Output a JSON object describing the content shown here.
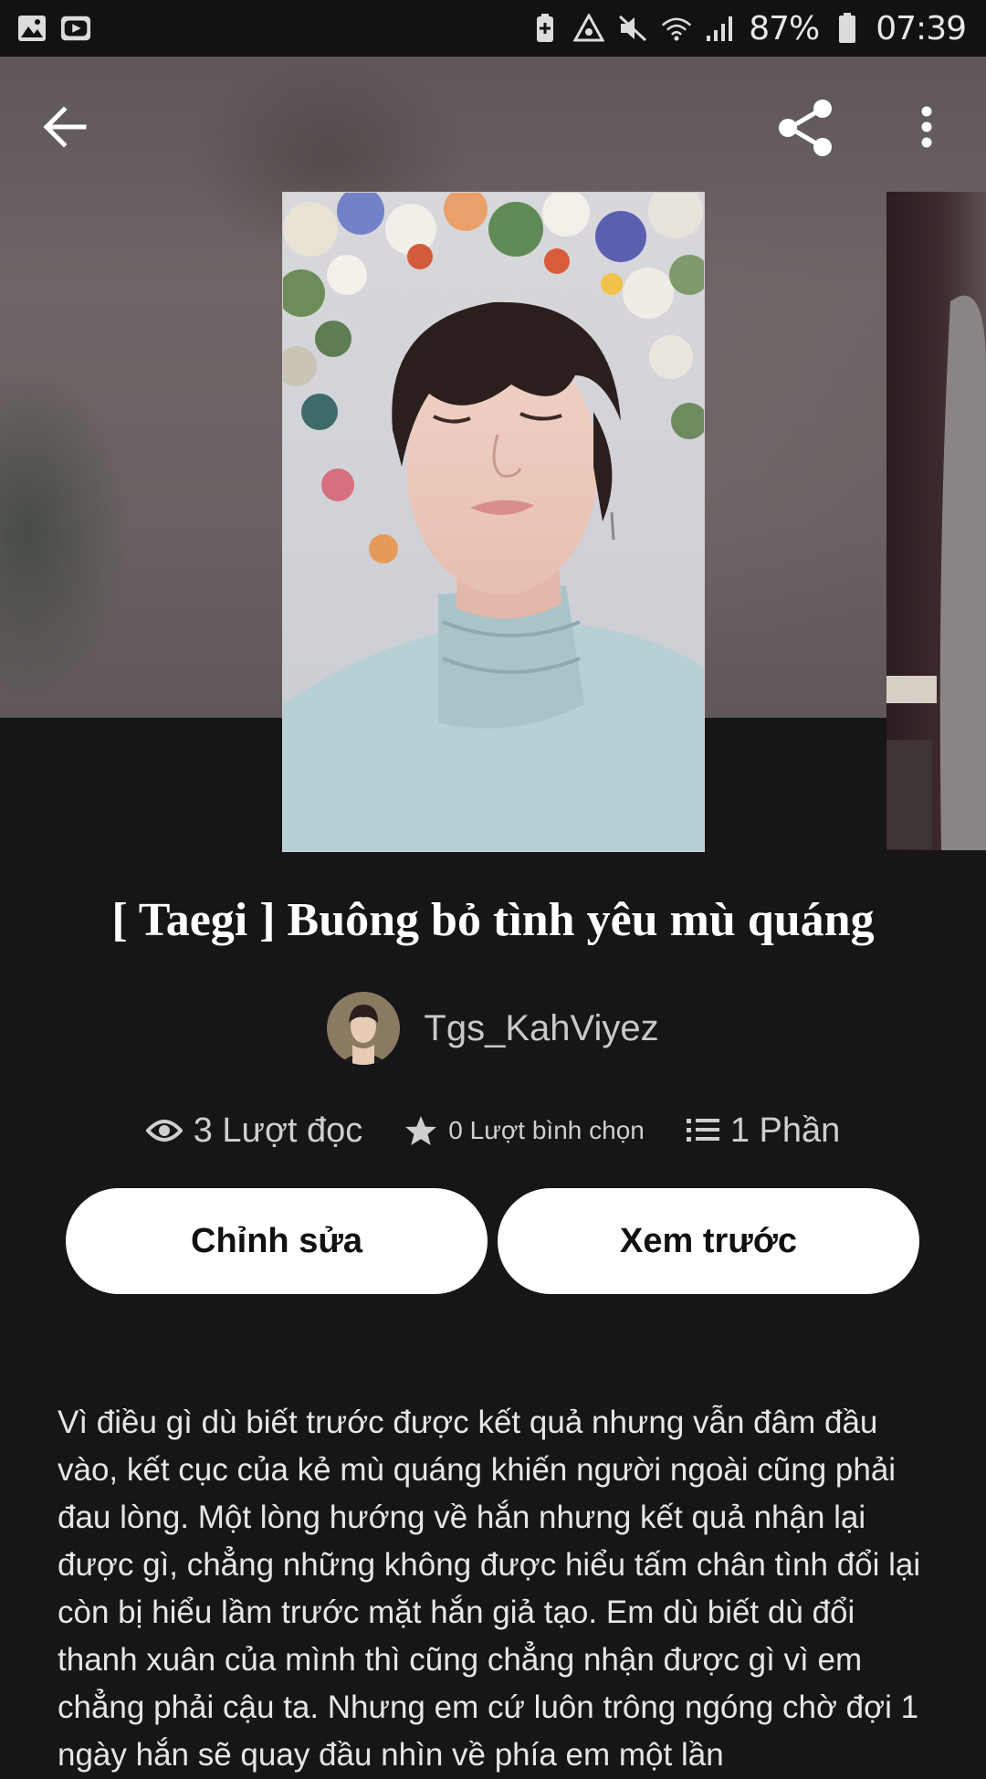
{
  "status_bar": {
    "battery": "87%",
    "time": "07:39"
  },
  "story": {
    "title": "[ Taegi ] Buông bỏ tình yêu mù quáng",
    "author": "Tgs_KahViyez",
    "stats": {
      "reads": "3 Lượt đọc",
      "votes": "0 Lượt bình chọn",
      "parts": "1 Phần"
    },
    "description": "Vì điều gì dù biết trước được kết quả nhưng vẫn đâm đầu vào, kết cục của kẻ mù quáng khiến người ngoài cũng phải đau lòng. Một lòng hướng về hắn nhưng kết quả nhận lại được gì, chẳng những không được hiểu tấm chân tình đổi lại còn bị hiểu lầm trước mặt hắn giả tạo. Em dù biết dù đổi thanh xuân của mình thì cũng chẳng nhận được gì vì em chẳng phải cậu ta. Nhưng em cứ luôn trông ngóng chờ đợi 1 ngày hắn sẽ quay đầu nhìn về phía em một lần"
  },
  "actions": {
    "edit": "Chỉnh sửa",
    "preview": "Xem trước"
  },
  "icons": {
    "back": "arrow-left-icon",
    "share": "share-icon",
    "more": "more-vert-icon",
    "reads": "eye-icon",
    "votes": "star-icon",
    "parts": "list-icon"
  },
  "colors": {
    "background": "#161517",
    "button": "#ffffff",
    "button_text": "#111111"
  }
}
